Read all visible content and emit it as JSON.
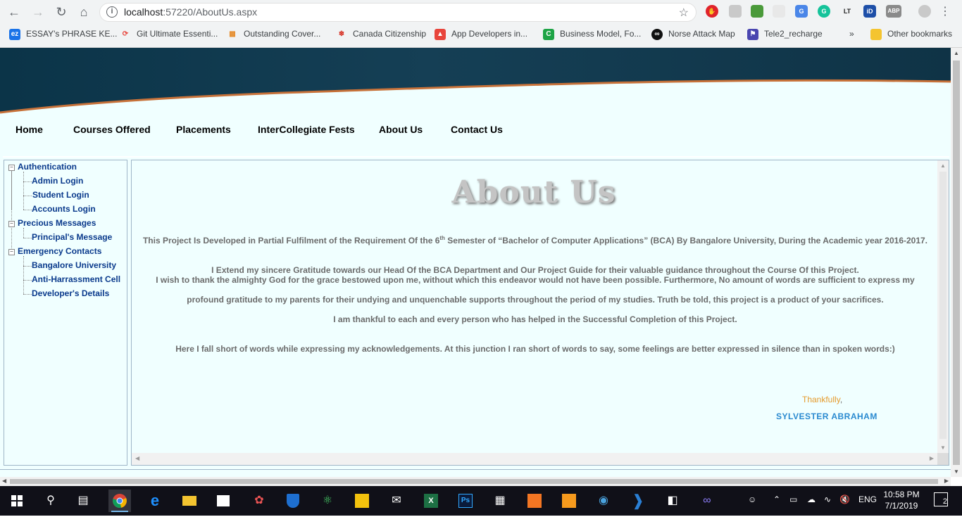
{
  "browser": {
    "url_host": "localhost",
    "url_path": ":57220/AboutUs.aspx",
    "bookmarks": [
      {
        "label": "ESSAY's PHRASE KE...",
        "icon": "ez-icon",
        "color": "#1a73e8"
      },
      {
        "label": "Git Ultimate Essenti...",
        "icon": "git-icon",
        "color": "#e8453c"
      },
      {
        "label": "Outstanding Cover...",
        "icon": "chart-icon",
        "color": "#e58c2c"
      },
      {
        "label": "Canada Citizenship",
        "icon": "maple-leaf-icon",
        "color": "#d52b1e"
      },
      {
        "label": "App Developers in...",
        "icon": "app-dev-icon",
        "color": "#e8453c"
      },
      {
        "label": "Business Model, Fo...",
        "icon": "c-icon",
        "color": "#1ea446"
      },
      {
        "label": "Norse Attack Map",
        "icon": "norse-icon",
        "color": "#111111"
      },
      {
        "label": "Tele2_recharge",
        "icon": "flag-icon",
        "color": "#4a46b0"
      }
    ],
    "more_bookmarks": "»",
    "other_bookmarks": "Other bookmarks"
  },
  "nav": {
    "items": [
      "Home",
      "Courses Offered",
      "Placements",
      "InterCollegiate Fests",
      "About Us",
      "Contact Us"
    ]
  },
  "sidebar": {
    "authentication": "Authentication",
    "admin_login": "Admin Login",
    "student_login": "Student Login",
    "accounts_login": "Accounts Login",
    "precious_messages": "Precious Messages",
    "principals_message": "Principal's Message",
    "emergency_contacts": "Emergency Contacts",
    "bangalore_university": "Bangalore University",
    "anti_harrassment": "Anti-Harrassment Cell",
    "developers_details": "Developer's Details",
    "expander_symbol": "−"
  },
  "content": {
    "title": "About Us",
    "p1_before": "This Project Is Developed in Partial Fulfilment of the Requirement Of the 6",
    "p1_sup": "th",
    "p1_after": " Semester of “Bachelor of  Computer Applications” (BCA) By Bangalore University, During the Academic year 2016-2017.",
    "p2": "I Extend my sincere Gratitude towards our Head Of the BCA Department and Our Project Guide  for their valuable guidance throughout the Course Of this Project.",
    "p3": "I wish to thank the almighty God for the grace bestowed upon me, without which this endeavor would not have been possible. Furthermore, No amount of words are sufficient to express my",
    "p4": "profound gratitude to my parents for their undying and unquenchable supports throughout the period of my studies. Truth be told, this project is a product of your sacrifices.",
    "p5": "I am thankful to each and every person who has helped in the Successful Completion of this Project.",
    "p6": "Here I fall short of words while expressing my acknowledgements. At this junction I ran short of words to say, some feelings are better expressed in silence than in  spoken words:)",
    "thankfully": "Thankfully",
    "comma": ",",
    "signer": "SYLVESTER  ABRAHAM"
  },
  "taskbar": {
    "language": "ENG",
    "time": "10:58 PM",
    "date": "7/1/2019",
    "notifications": "2"
  },
  "colors": {
    "page_bg": "#f0ffff",
    "link": "#0a3a8c",
    "accent_orange": "#e59a2c",
    "signer_blue": "#2a8ad0",
    "banner_dark": "#0f3a4d"
  }
}
